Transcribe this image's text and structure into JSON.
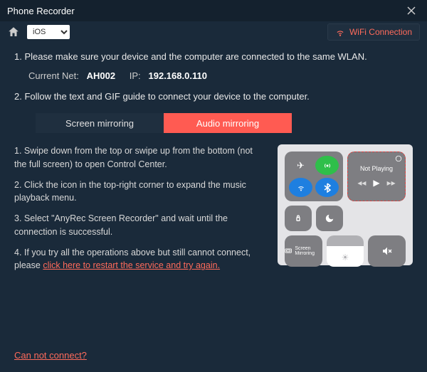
{
  "window": {
    "title": "Phone Recorder"
  },
  "toolbar": {
    "platform_selected": "iOS",
    "wifi_label": "WiFi Connection"
  },
  "steps": {
    "step1": "1. Please make sure your device and the computer are connected to the same WLAN.",
    "net_label": "Current Net:",
    "net_name": "AH002",
    "ip_label": "IP:",
    "ip_value": "192.168.0.110",
    "step2": "2. Follow the text and GIF guide to connect your device to the computer."
  },
  "tabs": {
    "screen": "Screen mirroring",
    "audio": "Audio mirroring"
  },
  "guide": {
    "g1": "1. Swipe down from the top or swipe up from the bottom (not the full screen) to open Control Center.",
    "g2": "2. Click the icon in the top-right corner to expand the music playback menu.",
    "g3": "3. Select \"AnyRec Screen Recorder\" and wait until the connection is successful.",
    "g4a": "4. If you try all the operations above but still cannot connect, please ",
    "g4b": "click here to restart the service and try again."
  },
  "control_center": {
    "not_playing": "Not Playing",
    "screen_mirroring": "Screen Mirroring"
  },
  "footer": {
    "cannot_connect": "Can not connect?"
  }
}
